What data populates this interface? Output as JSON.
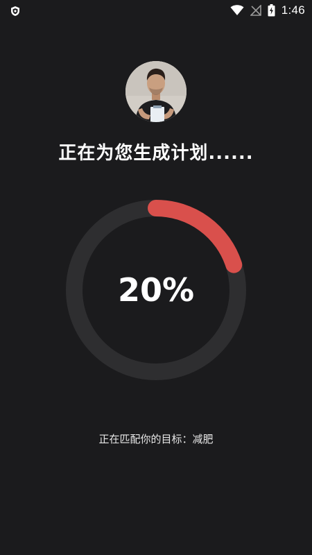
{
  "status_bar": {
    "time": "1:46",
    "icons": [
      "shield-icon",
      "wifi-icon",
      "no-signal-icon",
      "battery-charging-icon"
    ]
  },
  "headline": "正在为您生成计划......",
  "progress": {
    "value": 0.2,
    "label": "20%",
    "track_color": "#2e2e30",
    "fill_color": "#d9504c"
  },
  "goal_line": {
    "prefix": "正在匹配你的目标：",
    "goal": "减肥"
  },
  "colors": {
    "background": "#1b1b1d",
    "text": "#ffffff",
    "accent": "#d9504c"
  }
}
